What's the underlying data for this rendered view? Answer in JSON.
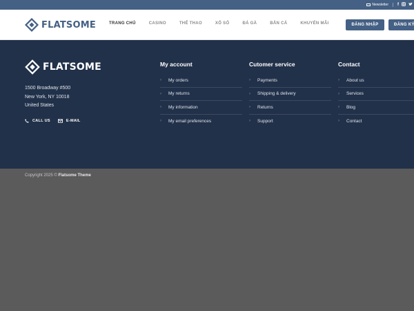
{
  "colors": {
    "primary": "#446084",
    "footer_bg": "#22314a",
    "page_bg": "#5b5b5b"
  },
  "topbar": {
    "newsletter_label": "Newsletter",
    "social": [
      "facebook-icon",
      "instagram-icon",
      "twitter-icon"
    ]
  },
  "header": {
    "logo_text": "FLATSOME",
    "nav": [
      "TRANG CHỦ",
      "CASINO",
      "THỂ THAO",
      "XỔ SỐ",
      "ĐÁ GÀ",
      "BẮN CÁ",
      "KHUYẾN MÃI"
    ],
    "login_label": "ĐĂNG NHẬP",
    "register_label": "ĐĂNG KÝ"
  },
  "footer": {
    "logo_text": "FLATSOME",
    "address": [
      "1500 Broadway #500",
      "New York, NY 10018",
      "United States"
    ],
    "call_label": "CALL US",
    "email_label": "E-MAIL",
    "columns": [
      {
        "title": "My account",
        "items": [
          "My orders",
          "My returns",
          "My information",
          "My email preferences"
        ]
      },
      {
        "title": "Cutomer service",
        "items": [
          "Payments",
          "Shipping & delivery",
          "Returns",
          "Support"
        ]
      },
      {
        "title": "Contact",
        "items": [
          "About us",
          "Services",
          "Blog",
          "Contact"
        ]
      }
    ]
  },
  "copyright": {
    "prefix": "Copyright 2025 ©",
    "theme": "Flatsome Theme"
  }
}
